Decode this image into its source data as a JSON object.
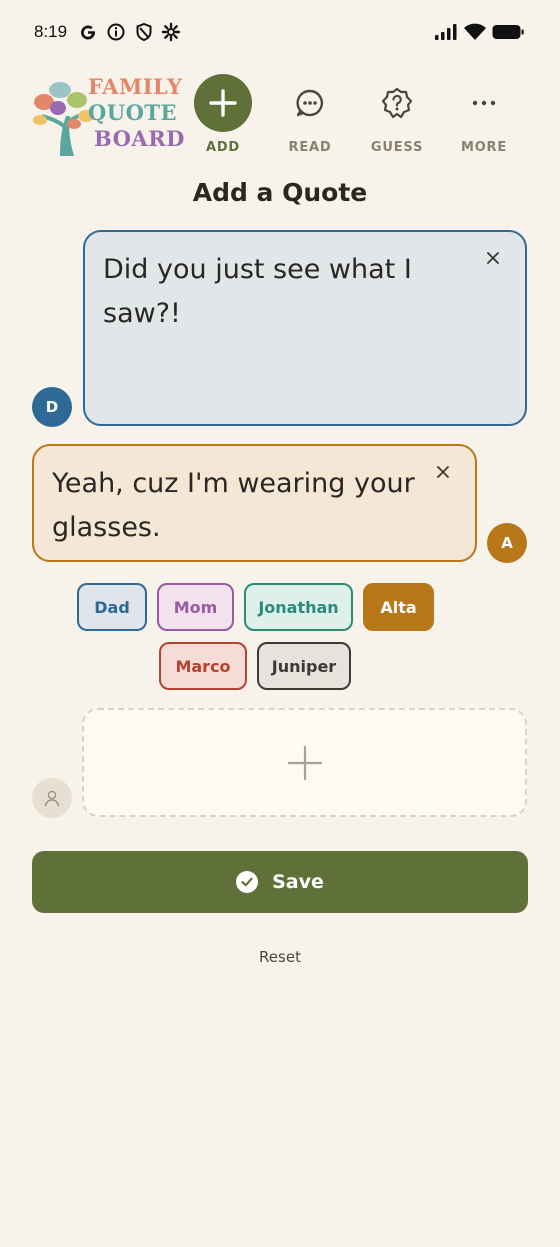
{
  "status_bar": {
    "time": "8:19",
    "left_icons": [
      "google-icon",
      "info-icon",
      "shield-icon",
      "gear-icon"
    ],
    "right_icons": [
      "signal-icon",
      "wifi-icon",
      "battery-icon"
    ]
  },
  "logo": {
    "line1": "FAMILY",
    "line2": "QUOTE",
    "line3": "BOARD"
  },
  "nav": {
    "add": "ADD",
    "read": "READ",
    "guess": "GUESS",
    "more": "MORE"
  },
  "page_title": "Add a Quote",
  "quotes": [
    {
      "speaker_initial": "D",
      "text": "Did you just see what I saw?!",
      "color": "#2f6a97",
      "bg": "#e1e6e8"
    },
    {
      "speaker_initial": "A",
      "text": "Yeah, cuz I'm wearing your glasses.",
      "color": "#b8781a",
      "bg": "#f4e7d6"
    }
  ],
  "people": [
    {
      "name": "Dad",
      "color": "#2f6a97",
      "selected": false
    },
    {
      "name": "Mom",
      "color": "#9a5aa5",
      "selected": false
    },
    {
      "name": "Jonathan",
      "color": "#2d8a78",
      "selected": false
    },
    {
      "name": "Alta",
      "color": "#b8781a",
      "selected": true
    },
    {
      "name": "Marco",
      "color": "#b5432f",
      "selected": false
    },
    {
      "name": "Juniper",
      "color": "#3b3a36",
      "selected": false
    }
  ],
  "save_label": "Save",
  "reset_label": "Reset",
  "colors": {
    "accent": "#5f7138",
    "background": "#f7f3ea"
  }
}
